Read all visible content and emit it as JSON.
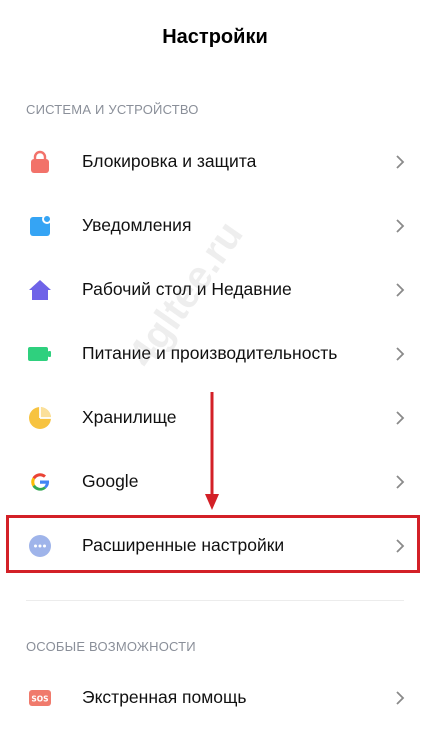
{
  "header": {
    "title": "Настройки"
  },
  "sections": [
    {
      "title": "СИСТЕМА И УСТРОЙСТВО"
    },
    {
      "title": "ОСОБЫЕ ВОЗМОЖНОСТИ"
    }
  ],
  "items": [
    {
      "label": "Блокировка и защита",
      "icon": "lock-icon"
    },
    {
      "label": "Уведомления",
      "icon": "notifications-icon"
    },
    {
      "label": "Рабочий стол и Недавние",
      "icon": "home-icon"
    },
    {
      "label": "Питание и производительность",
      "icon": "battery-icon"
    },
    {
      "label": "Хранилище",
      "icon": "storage-pie-icon"
    },
    {
      "label": "Google",
      "icon": "google-icon"
    },
    {
      "label": "Расширенные настройки",
      "icon": "more-dots-icon"
    },
    {
      "label": "Экстренная помощь",
      "icon": "sos-icon"
    }
  ],
  "watermark": "4gltee.ru",
  "colors": {
    "lock": "#f2726a",
    "notifications": "#35a4f4",
    "home": "#6f63e8",
    "battery": "#2fd07e",
    "storage": "#f7c340",
    "more": "#9fb4ea",
    "sos": "#f07a6c",
    "highlight": "#d32027"
  }
}
